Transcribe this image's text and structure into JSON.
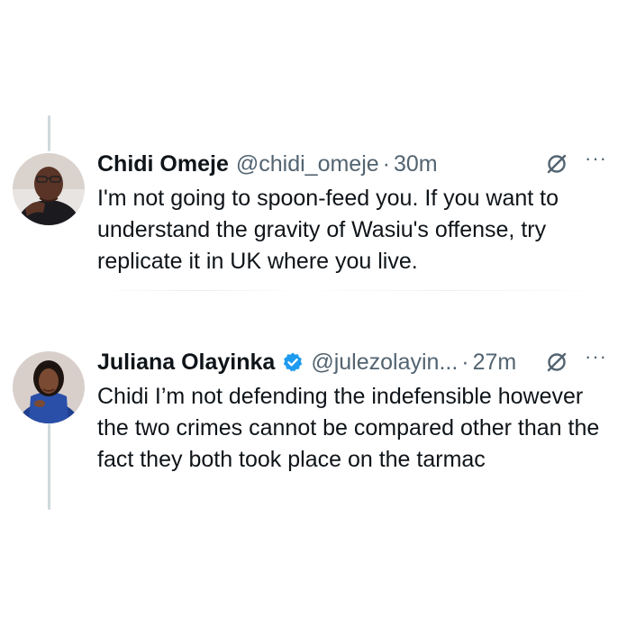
{
  "tweets": [
    {
      "name": "Chidi Omeje",
      "handle": "@chidi_omeje",
      "separator": "·",
      "time": "30m",
      "verified": false,
      "text": "I'm not going to spoon-feed you. If you want to understand the gravity of Wasiu's offense, try replicate it in UK where you live."
    },
    {
      "name": "Juliana Olayinka",
      "handle": "@julezolayin...",
      "separator": "·",
      "time": "27m",
      "verified": true,
      "text": "Chidi I’m not defending the indefensible however the two crimes cannot be compared other than the fact they both took place on the tarmac"
    }
  ],
  "icons": {
    "grok": "grok-icon",
    "more": "more-icon",
    "verified": "verified-badge-icon"
  },
  "more_glyph": "···",
  "colors": {
    "text": "#0f1419",
    "secondary": "#536471",
    "verified": "#1d9bf0",
    "thread_line": "#cfd9de"
  }
}
